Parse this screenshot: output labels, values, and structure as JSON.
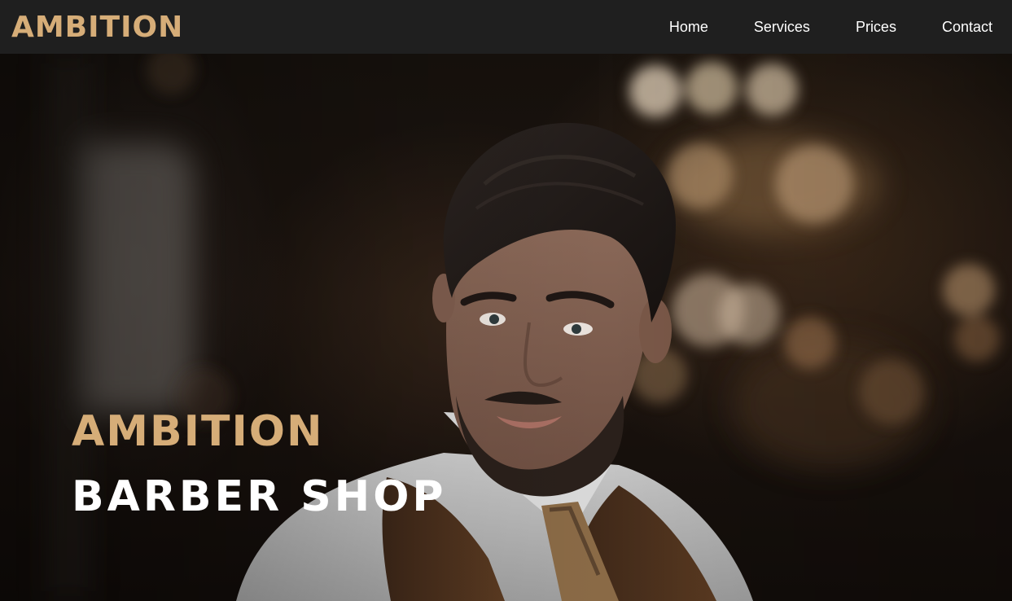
{
  "brand": {
    "logo_text": "AMBITION",
    "accent_color": "#d6ad78"
  },
  "nav": {
    "items": [
      {
        "label": "Home"
      },
      {
        "label": "Services"
      },
      {
        "label": "Prices"
      },
      {
        "label": "Contact"
      }
    ]
  },
  "hero": {
    "title_line1": "AMBITION",
    "title_line2": "BARBER SHOP",
    "background_subject": "man-portrait-photo"
  }
}
